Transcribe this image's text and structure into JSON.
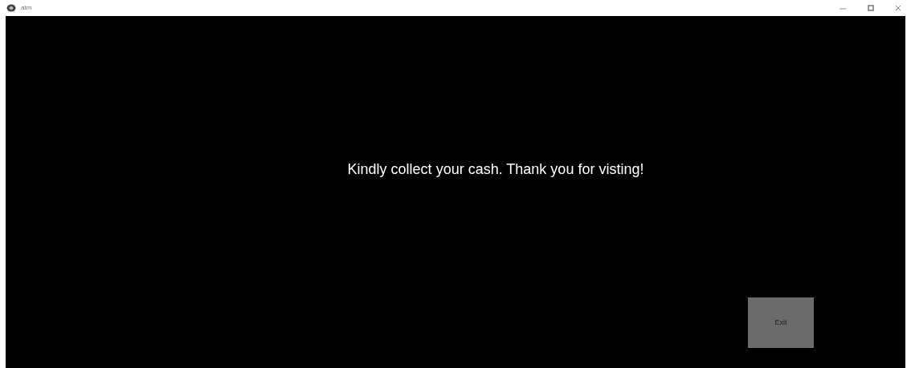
{
  "window": {
    "title": "atm"
  },
  "message": "Kindly collect your cash. Thank you for visting!",
  "buttons": [
    {
      "label": "Exit"
    }
  ]
}
